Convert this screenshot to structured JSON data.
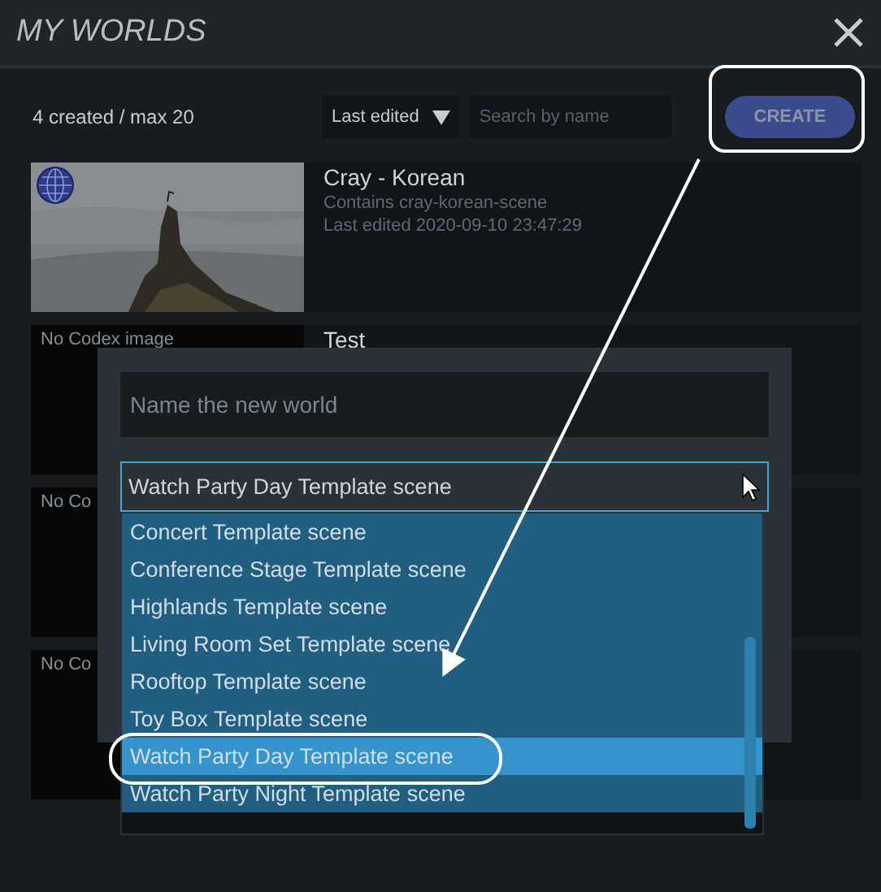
{
  "window": {
    "title": "MY WORLDS"
  },
  "summary": "4 created / max 20",
  "sort": {
    "value": "Last edited"
  },
  "search": {
    "placeholder": "Search by name"
  },
  "create_button": "CREATE",
  "worlds": [
    {
      "kind": "picture",
      "title": "Cray - Korean",
      "contains": "Contains cray-korean-scene",
      "last_edited": "Last edited 2020-09-10 23:47:29"
    },
    {
      "kind": "no_image",
      "image_text": "No Codex image",
      "title": "Test"
    },
    {
      "kind": "no_image",
      "image_text": "No Co"
    },
    {
      "kind": "no_image",
      "image_text": "No Co"
    }
  ],
  "dialog": {
    "name_field": {
      "placeholder": "Name the new world"
    },
    "template_select": {
      "value": "Watch Party Day Template scene",
      "options": [
        {
          "label": "Concert Template scene",
          "selected": false
        },
        {
          "label": "Conference Stage Template scene",
          "selected": false
        },
        {
          "label": "Highlands Template scene",
          "selected": false
        },
        {
          "label": "Living Room Set Template scene",
          "selected": false
        },
        {
          "label": "Rooftop Template scene",
          "selected": false
        },
        {
          "label": "Toy Box Template scene",
          "selected": false
        },
        {
          "label": "Watch Party Day Template scene",
          "selected": true
        },
        {
          "label": "Watch Party Night Template scene",
          "selected": false
        }
      ]
    }
  }
}
